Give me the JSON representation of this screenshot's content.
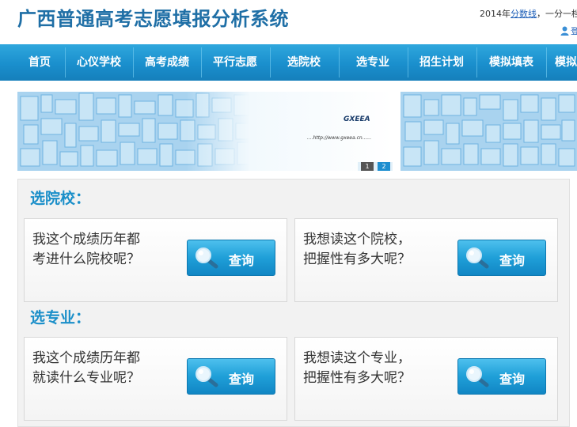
{
  "header": {
    "title": "广西普通高考志愿填报分析系统",
    "year_prefix": "2014年",
    "score_line_link": "分数线",
    "divider_text": "，一分一档",
    "user_link": "登录"
  },
  "nav": {
    "items": [
      "首页",
      "心仪学校",
      "高考成绩",
      "平行志愿",
      "选院校",
      "选专业",
      "招生计划",
      "模拟填表",
      "模拟"
    ]
  },
  "banner": {
    "logo_text": "GXEEA",
    "url_text": "....http://www.gxeea.cn......",
    "pager": [
      "1",
      "2"
    ]
  },
  "sections": {
    "school": {
      "title": "选院校：",
      "cards": [
        {
          "line1": "我这个成绩历年都",
          "line2": "考进什么院校呢？",
          "button": "查询"
        },
        {
          "line1": "我想读这个院校，",
          "line2": "把握性有多大呢？",
          "button": "查询"
        }
      ]
    },
    "major": {
      "title": "选专业：",
      "cards": [
        {
          "line1": "我这个成绩历年都",
          "line2": "就读什么专业呢？",
          "button": "查询"
        },
        {
          "line1": "我想读这个专业，",
          "line2": "把握性有多大呢？",
          "button": "查询"
        }
      ]
    }
  },
  "colors": {
    "title": "#1f6fa6",
    "nav_bg": "#1a8fcd",
    "section_title": "#1b8fc9",
    "button": "#1f9fd8"
  }
}
